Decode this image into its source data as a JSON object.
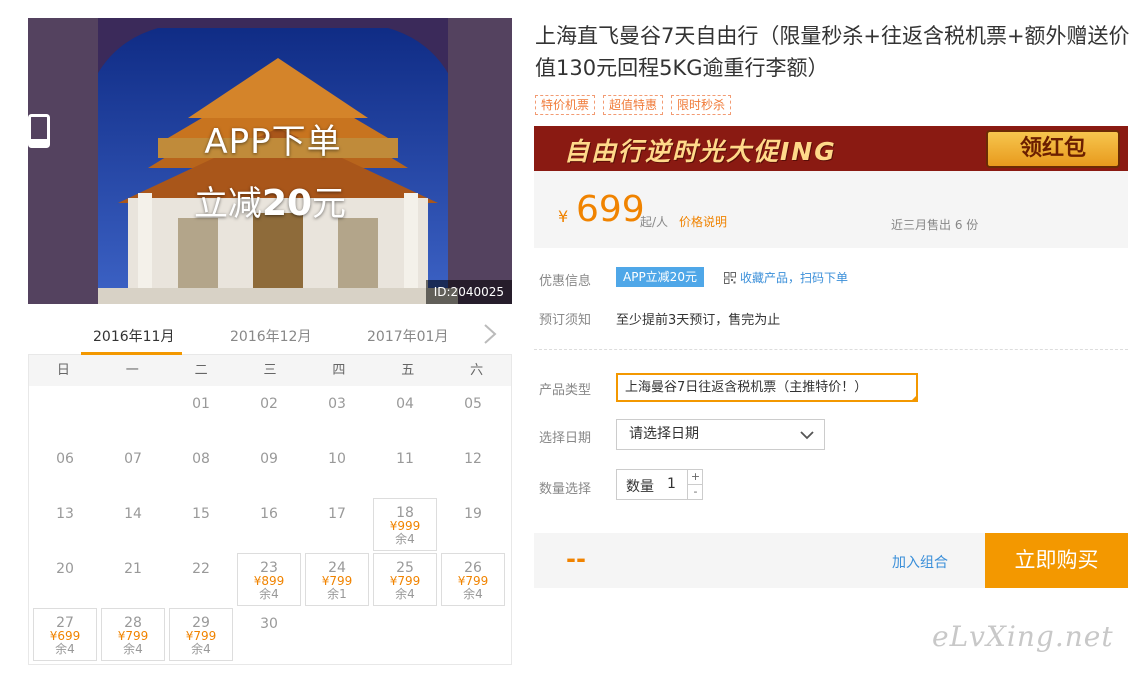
{
  "hero": {
    "promo_line1": "APP下单",
    "promo_line2_prefix": "立减",
    "promo_line2_amount": "20",
    "promo_line2_suffix": "元",
    "id_tag": "ID:2040025"
  },
  "calendar": {
    "months": [
      "2016年11月",
      "2016年12月",
      "2017年01月"
    ],
    "active_month": "2016年11月",
    "weekdays": [
      "日",
      "一",
      "二",
      "三",
      "四",
      "五",
      "六"
    ],
    "days": [
      {
        "d": "01"
      },
      {
        "d": "02"
      },
      {
        "d": "03"
      },
      {
        "d": "04"
      },
      {
        "d": "05"
      },
      {
        "d": "06"
      },
      {
        "d": "07"
      },
      {
        "d": "08"
      },
      {
        "d": "09"
      },
      {
        "d": "10"
      },
      {
        "d": "11"
      },
      {
        "d": "12"
      },
      {
        "d": "13"
      },
      {
        "d": "14"
      },
      {
        "d": "15"
      },
      {
        "d": "16"
      },
      {
        "d": "17"
      },
      {
        "d": "18",
        "price": "¥999",
        "left": "余4"
      },
      {
        "d": "19"
      },
      {
        "d": "20"
      },
      {
        "d": "21"
      },
      {
        "d": "22"
      },
      {
        "d": "23",
        "price": "¥899",
        "left": "余4"
      },
      {
        "d": "24",
        "price": "¥799",
        "left": "余1"
      },
      {
        "d": "25",
        "price": "¥799",
        "left": "余4"
      },
      {
        "d": "26",
        "price": "¥799",
        "left": "余4"
      },
      {
        "d": "27",
        "price": "¥699",
        "left": "余4"
      },
      {
        "d": "28",
        "price": "¥799",
        "left": "余4"
      },
      {
        "d": "29",
        "price": "¥799",
        "left": "余4"
      },
      {
        "d": "30"
      }
    ],
    "first_weekday": 2
  },
  "product": {
    "title": "上海直飞曼谷7天自由行（限量秒杀+往返含税机票+额外赠送价值130元回程5KG逾重行李额）",
    "tags": [
      "特价机票",
      "超值特惠",
      "限时秒杀"
    ],
    "banner_text": "自由行逆时光大促ING",
    "banner_button": "领红包",
    "currency": "¥",
    "price": "699",
    "per_unit": "起/人",
    "price_note": "价格说明",
    "sold": "近三月售出 6 份"
  },
  "info": {
    "discount_label": "优惠信息",
    "app_badge": "APP立减20元",
    "fav_link": "收藏产品，扫码下单",
    "notice_label": "预订须知",
    "notice_value": "至少提前3天预订，售完为止",
    "type_label": "产品类型",
    "type_value": "上海曼谷7日往返含税机票（主推特价！）",
    "date_label": "选择日期",
    "date_placeholder": "请选择日期",
    "qty_label": "数量选择",
    "qty_field_label": "数量",
    "qty_value": "1",
    "qty_up": "+",
    "qty_down": "-"
  },
  "buy": {
    "total": "--",
    "combo": "加入组合",
    "buy_now": "立即购买"
  },
  "watermark": "eLvXing.net",
  "colors": {
    "accent": "#f39800",
    "price": "#f08300",
    "link": "#3b8fd9",
    "badge": "#4fa7e8"
  }
}
